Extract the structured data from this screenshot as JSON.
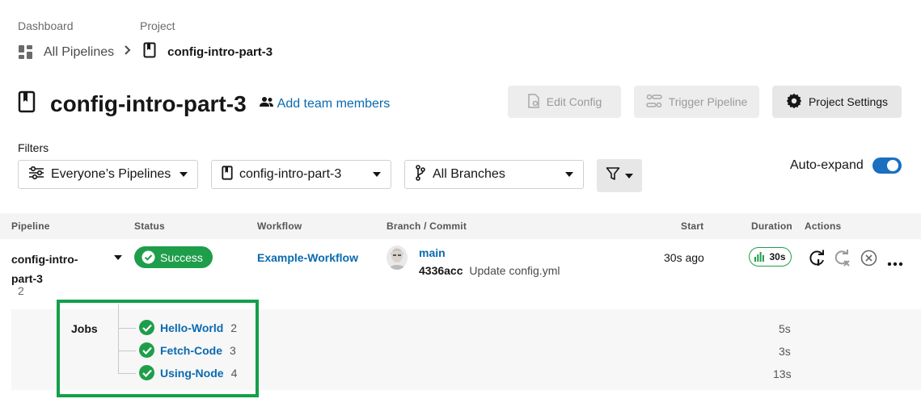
{
  "breadcrumb": {
    "dashboard_label": "Dashboard",
    "project_label": "Project",
    "all_pipelines": "All Pipelines",
    "project_name": "config-intro-part-3"
  },
  "header": {
    "title": "config-intro-part-3",
    "add_team_members": "Add team members",
    "edit_config": "Edit Config",
    "trigger_pipeline": "Trigger Pipeline",
    "project_settings": "Project Settings"
  },
  "filters": {
    "label": "Filters",
    "pipelines_select": "Everyone’s Pipelines",
    "project_select": "config-intro-part-3",
    "branch_select": "All Branches",
    "auto_expand_label": "Auto-expand",
    "auto_expand_on": true
  },
  "table": {
    "headers": {
      "pipeline": "Pipeline",
      "status": "Status",
      "workflow": "Workflow",
      "branch_commit": "Branch / Commit",
      "start": "Start",
      "duration": "Duration",
      "actions": "Actions"
    },
    "row": {
      "pipeline_line1": "config-intro-",
      "pipeline_line2": "part-3",
      "pipeline_number": "2",
      "status": "Success",
      "workflow": "Example-Workflow",
      "branch": "main",
      "commit_hash": "4336acc",
      "commit_message": "Update config.yml",
      "start": "30s ago",
      "duration": "30s"
    },
    "jobs": {
      "label": "Jobs",
      "items": [
        {
          "name": "Hello-World",
          "number": "2",
          "duration": "5s"
        },
        {
          "name": "Fetch-Code",
          "number": "3",
          "duration": "3s"
        },
        {
          "name": "Using-Node",
          "number": "4",
          "duration": "13s"
        }
      ]
    }
  },
  "colors": {
    "success": "#1e9e4a",
    "link": "#0a6ab0",
    "toggle": "#1a6fc0",
    "highlight_box": "#12a04a"
  }
}
